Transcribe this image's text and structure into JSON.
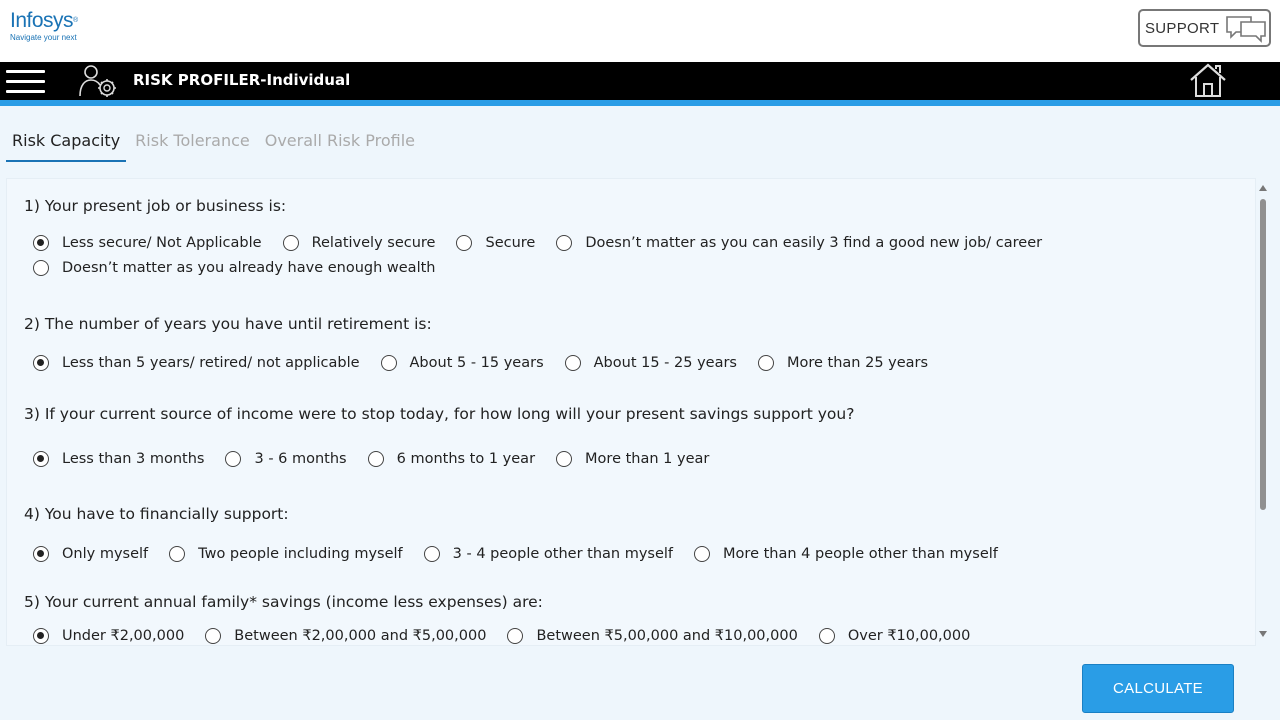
{
  "brand": {
    "name": "Infosys",
    "tagline": "Navigate your next",
    "reg": "®"
  },
  "header": {
    "support_label": "SUPPORT"
  },
  "nav": {
    "title": "RISK PROFILER-Individual"
  },
  "tabs": [
    {
      "label": "Risk Capacity",
      "active": true
    },
    {
      "label": "Risk Tolerance",
      "active": false
    },
    {
      "label": "Overall Risk Profile",
      "active": false
    }
  ],
  "questions": [
    {
      "text": "1) Your present job or business is:",
      "options": [
        {
          "label": "Less secure/ Not Applicable",
          "selected": true
        },
        {
          "label": "Relatively secure",
          "selected": false
        },
        {
          "label": "Secure",
          "selected": false
        },
        {
          "label": "Doesn’t matter as you can easily 3 find a good new job/ career",
          "selected": false
        },
        {
          "label": "Doesn’t matter as you already have enough wealth",
          "selected": false
        }
      ]
    },
    {
      "text": "2) The number of years you have until retirement is:",
      "options": [
        {
          "label": "Less than 5 years/ retired/ not applicable",
          "selected": true
        },
        {
          "label": "About 5 - 15 years",
          "selected": false
        },
        {
          "label": "About 15 - 25 years",
          "selected": false
        },
        {
          "label": "More than 25 years",
          "selected": false
        }
      ]
    },
    {
      "text": "3) If your current source of income were to stop today, for how long will your present savings support you?",
      "options": [
        {
          "label": "Less than 3 months",
          "selected": true
        },
        {
          "label": "3 - 6 months",
          "selected": false
        },
        {
          "label": "6 months to 1 year",
          "selected": false
        },
        {
          "label": "More than 1 year",
          "selected": false
        }
      ]
    },
    {
      "text": "4) You have to financially support:",
      "options": [
        {
          "label": "Only myself",
          "selected": true
        },
        {
          "label": "Two people including myself",
          "selected": false
        },
        {
          "label": "3 - 4 people other than myself",
          "selected": false
        },
        {
          "label": "More than 4 people other than myself",
          "selected": false
        }
      ]
    },
    {
      "text": "5) Your current annual family* savings (income less expenses) are:",
      "options": [
        {
          "label": "Under ₹2,00,000",
          "selected": true
        },
        {
          "label": "Between ₹2,00,000 and ₹5,00,000",
          "selected": false
        },
        {
          "label": "Between ₹5,00,000 and ₹10,00,000",
          "selected": false
        },
        {
          "label": "Over ₹10,00,000",
          "selected": false
        }
      ]
    }
  ],
  "actions": {
    "calculate_label": "CALCULATE"
  },
  "colors": {
    "accent": "#2a9de6",
    "brand": "#1a73b5",
    "nav_bg": "#000000",
    "page_bg": "#eef6fc"
  },
  "icons": {
    "menu": "hamburger-menu-icon",
    "profiler": "risk-profiler-icon",
    "support": "chat-bubbles-icon",
    "home": "home-icon"
  }
}
